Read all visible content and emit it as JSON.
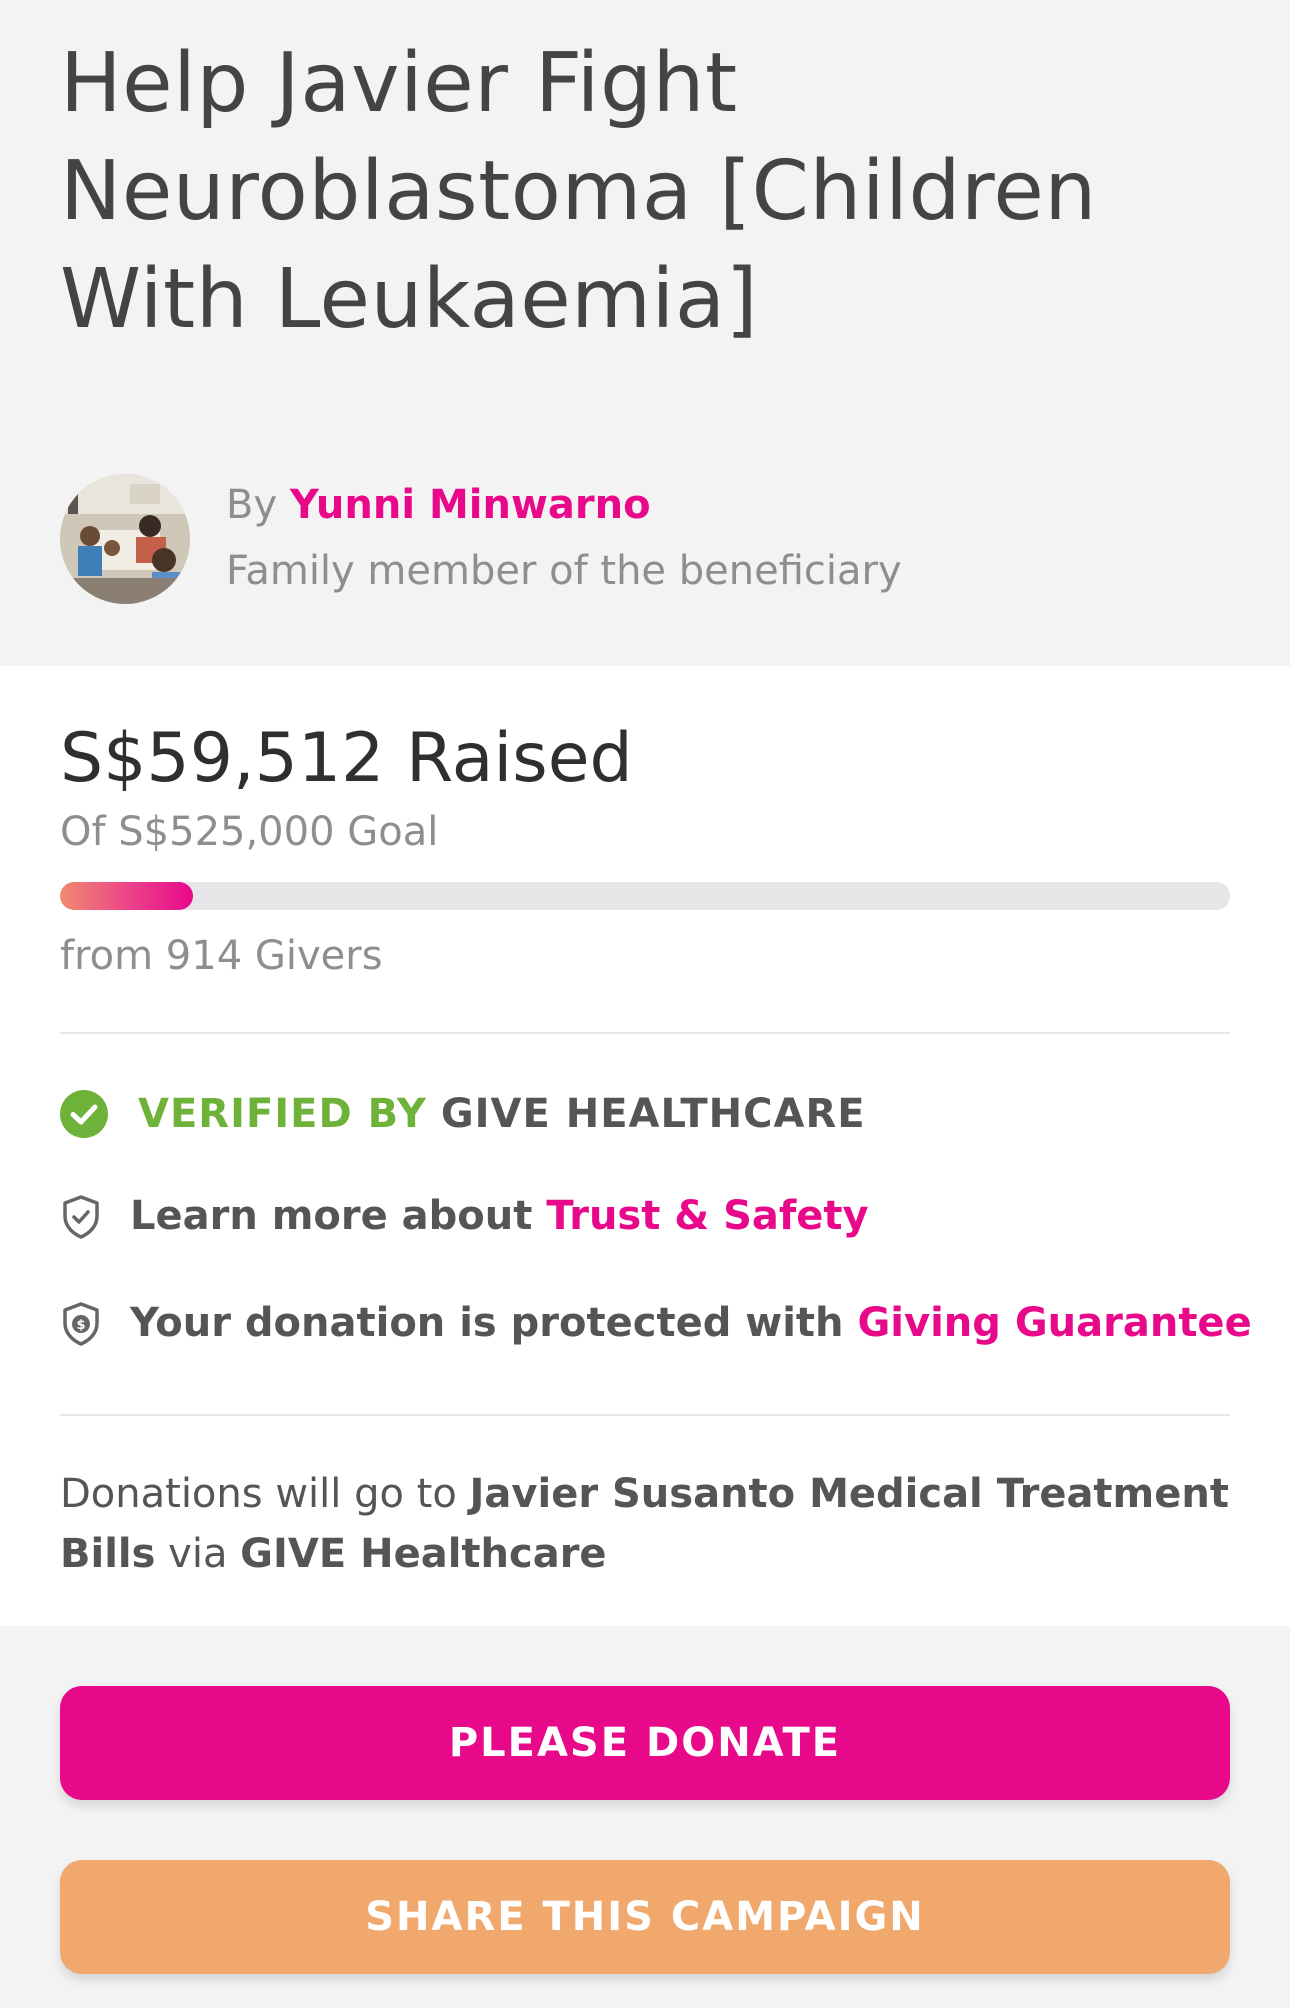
{
  "campaign": {
    "title": "Help Javier Fight Neuroblastoma [Children With Leukaemia]"
  },
  "organizer": {
    "by_prefix": "By",
    "name": "Yunni Minwarno",
    "relation": "Family member of the beneficiary"
  },
  "funding": {
    "raised_text": "S$59,512 Raised",
    "goal_text": "Of S$525,000 Goal",
    "progress_fraction": 0.1134,
    "givers_text": "from 914 Givers"
  },
  "verification": {
    "verified_label": "VERIFIED BY",
    "verified_org": "GIVE HEALTHCARE",
    "trust_prefix": "Learn more about",
    "trust_link": "Trust & Safety",
    "guarantee_prefix": "Your donation is protected with",
    "guarantee_link": "Giving Guarantee"
  },
  "beneficiary": {
    "prefix": "Donations will go to",
    "target": "Javier Susanto Medical Treatment Bills",
    "via": "via",
    "org": "GIVE Healthcare"
  },
  "actions": {
    "donate_label": "PLEASE DONATE",
    "share_label": "SHARE THIS CAMPAIGN"
  },
  "colors": {
    "brand_pink": "#e8098b",
    "verified_green": "#6fb23a",
    "share_orange": "#f0a86c"
  },
  "icons": {
    "verified": "check-circle-icon",
    "trust": "shield-check-icon",
    "guarantee": "shield-dollar-icon"
  }
}
